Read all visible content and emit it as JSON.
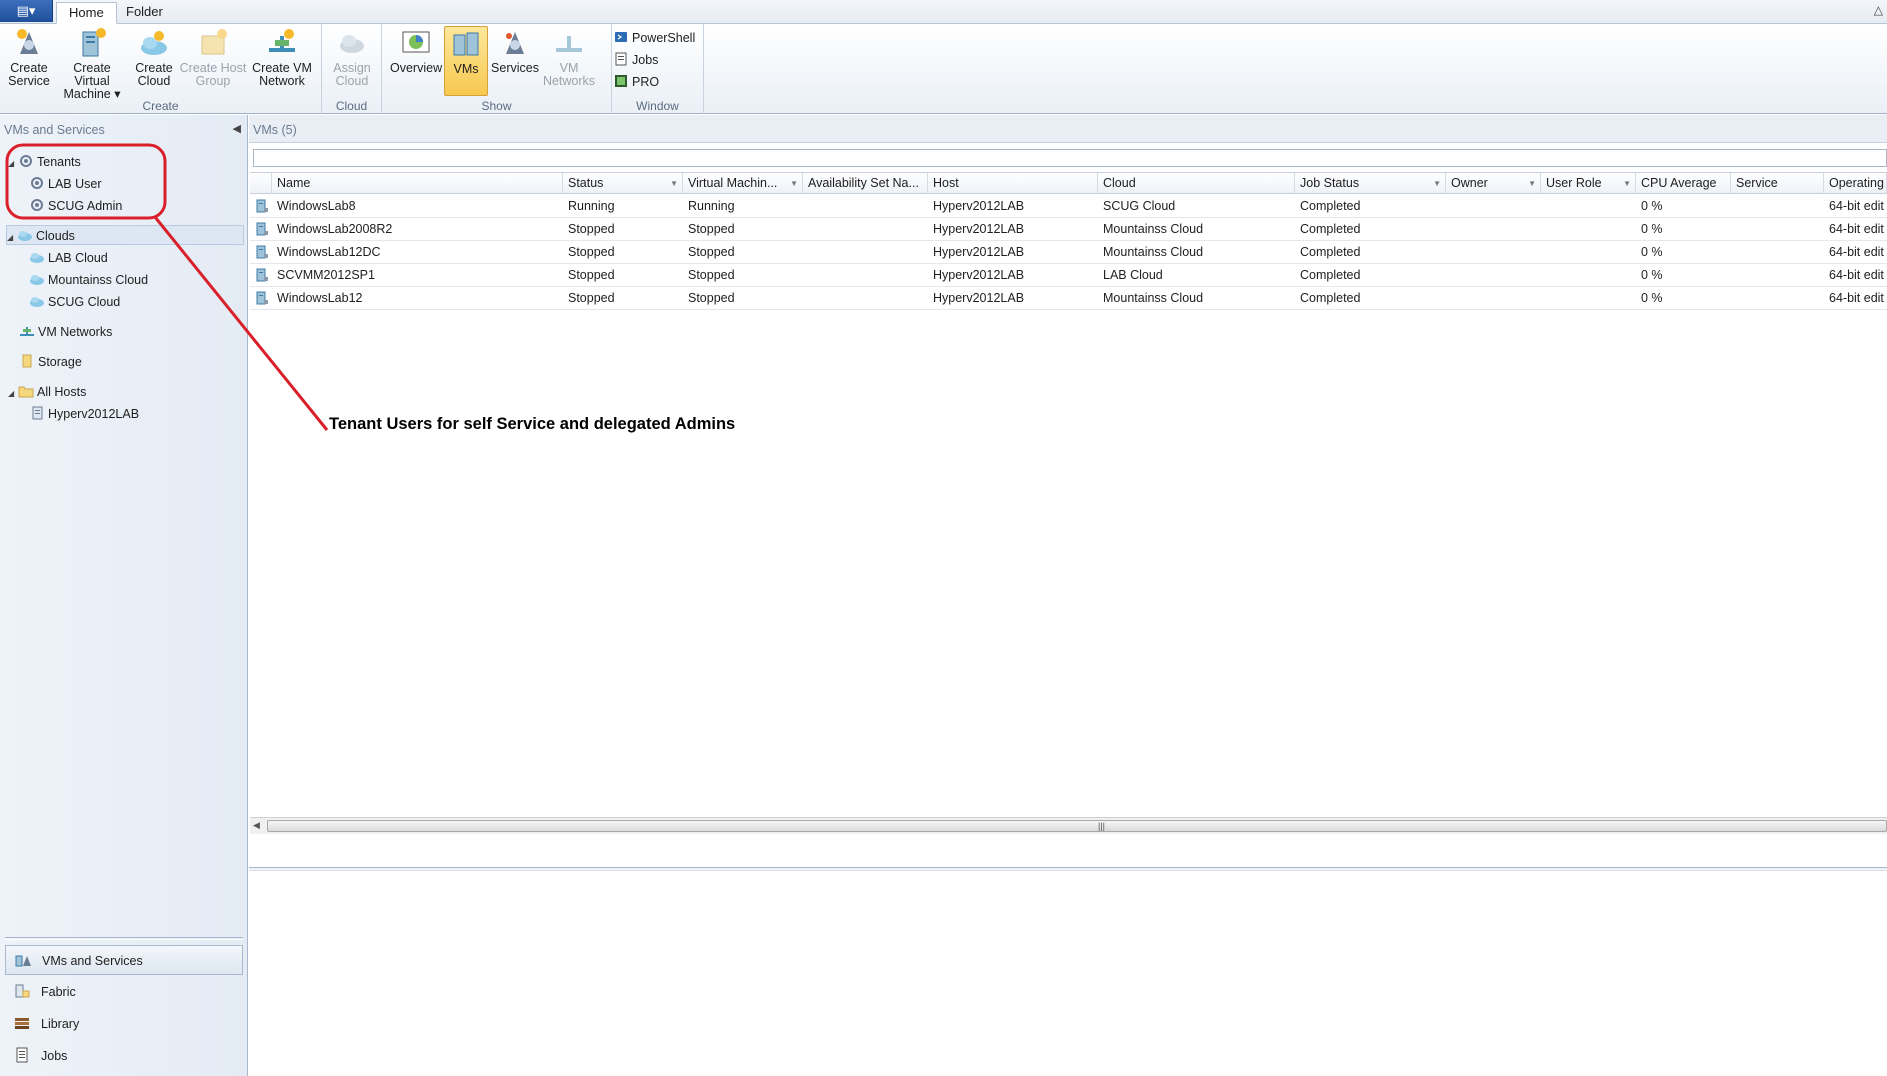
{
  "ribbon": {
    "tabs": [
      "Home",
      "Folder"
    ],
    "groups": {
      "create": "Create",
      "cloud": "Cloud",
      "show": "Show",
      "window": "Window"
    },
    "buttons": {
      "create_service": [
        "Create",
        "Service"
      ],
      "create_vm": [
        "Create Virtual",
        "Machine ▾"
      ],
      "create_cloud": [
        "Create",
        "Cloud"
      ],
      "create_host_group": [
        "Create Host",
        "Group"
      ],
      "create_vm_network": [
        "Create VM",
        "Network"
      ],
      "assign_cloud": [
        "Assign",
        "Cloud"
      ],
      "overview": "Overview",
      "vms": "VMs",
      "services": "Services",
      "vm_networks": [
        "VM",
        "Networks"
      ],
      "powershell": "PowerShell",
      "jobs": "Jobs",
      "pro": "PRO"
    }
  },
  "nav": {
    "header": "VMs and Services",
    "tree": {
      "tenants": "Tenants",
      "lab_user": "LAB User",
      "scug_admin": "SCUG Admin",
      "clouds": "Clouds",
      "lab_cloud": "LAB Cloud",
      "mountainss_cloud": "Mountainss Cloud",
      "scug_cloud": "SCUG Cloud",
      "vm_networks": "VM Networks",
      "storage": "Storage",
      "all_hosts": "All Hosts",
      "host": "Hyperv2012LAB"
    },
    "wunderbar": [
      "VMs and Services",
      "Fabric",
      "Library",
      "Jobs"
    ]
  },
  "main": {
    "header": "VMs (5)",
    "columns": [
      "Name",
      "Status",
      "Virtual Machin...",
      "Availability Set Na...",
      "Host",
      "Cloud",
      "Job Status",
      "Owner",
      "User Role",
      "CPU Average",
      "Service",
      "Operating"
    ],
    "rows": [
      [
        "WindowsLab8",
        "Running",
        "Running",
        "",
        "Hyperv2012LAB",
        "SCUG Cloud",
        "Completed",
        "",
        "",
        "0 %",
        "",
        "64-bit edit"
      ],
      [
        "WindowsLab2008R2",
        "Stopped",
        "Stopped",
        "",
        "Hyperv2012LAB",
        "Mountainss Cloud",
        "Completed",
        "",
        "",
        "0 %",
        "",
        "64-bit edit"
      ],
      [
        "WindowsLab12DC",
        "Stopped",
        "Stopped",
        "",
        "Hyperv2012LAB",
        "Mountainss Cloud",
        "Completed",
        "",
        "",
        "0 %",
        "",
        "64-bit edit"
      ],
      [
        "SCVMM2012SP1",
        "Stopped",
        "Stopped",
        "",
        "Hyperv2012LAB",
        "LAB Cloud",
        "Completed",
        "",
        "",
        "0 %",
        "",
        "64-bit edit"
      ],
      [
        "WindowsLab12",
        "Stopped",
        "Stopped",
        "",
        "Hyperv2012LAB",
        "Mountainss Cloud",
        "Completed",
        "",
        "",
        "0 %",
        "",
        "64-bit edit"
      ]
    ]
  },
  "annotation": {
    "text": "Tenant Users for self Service and delegated Admins",
    "color": "#d9202a"
  }
}
